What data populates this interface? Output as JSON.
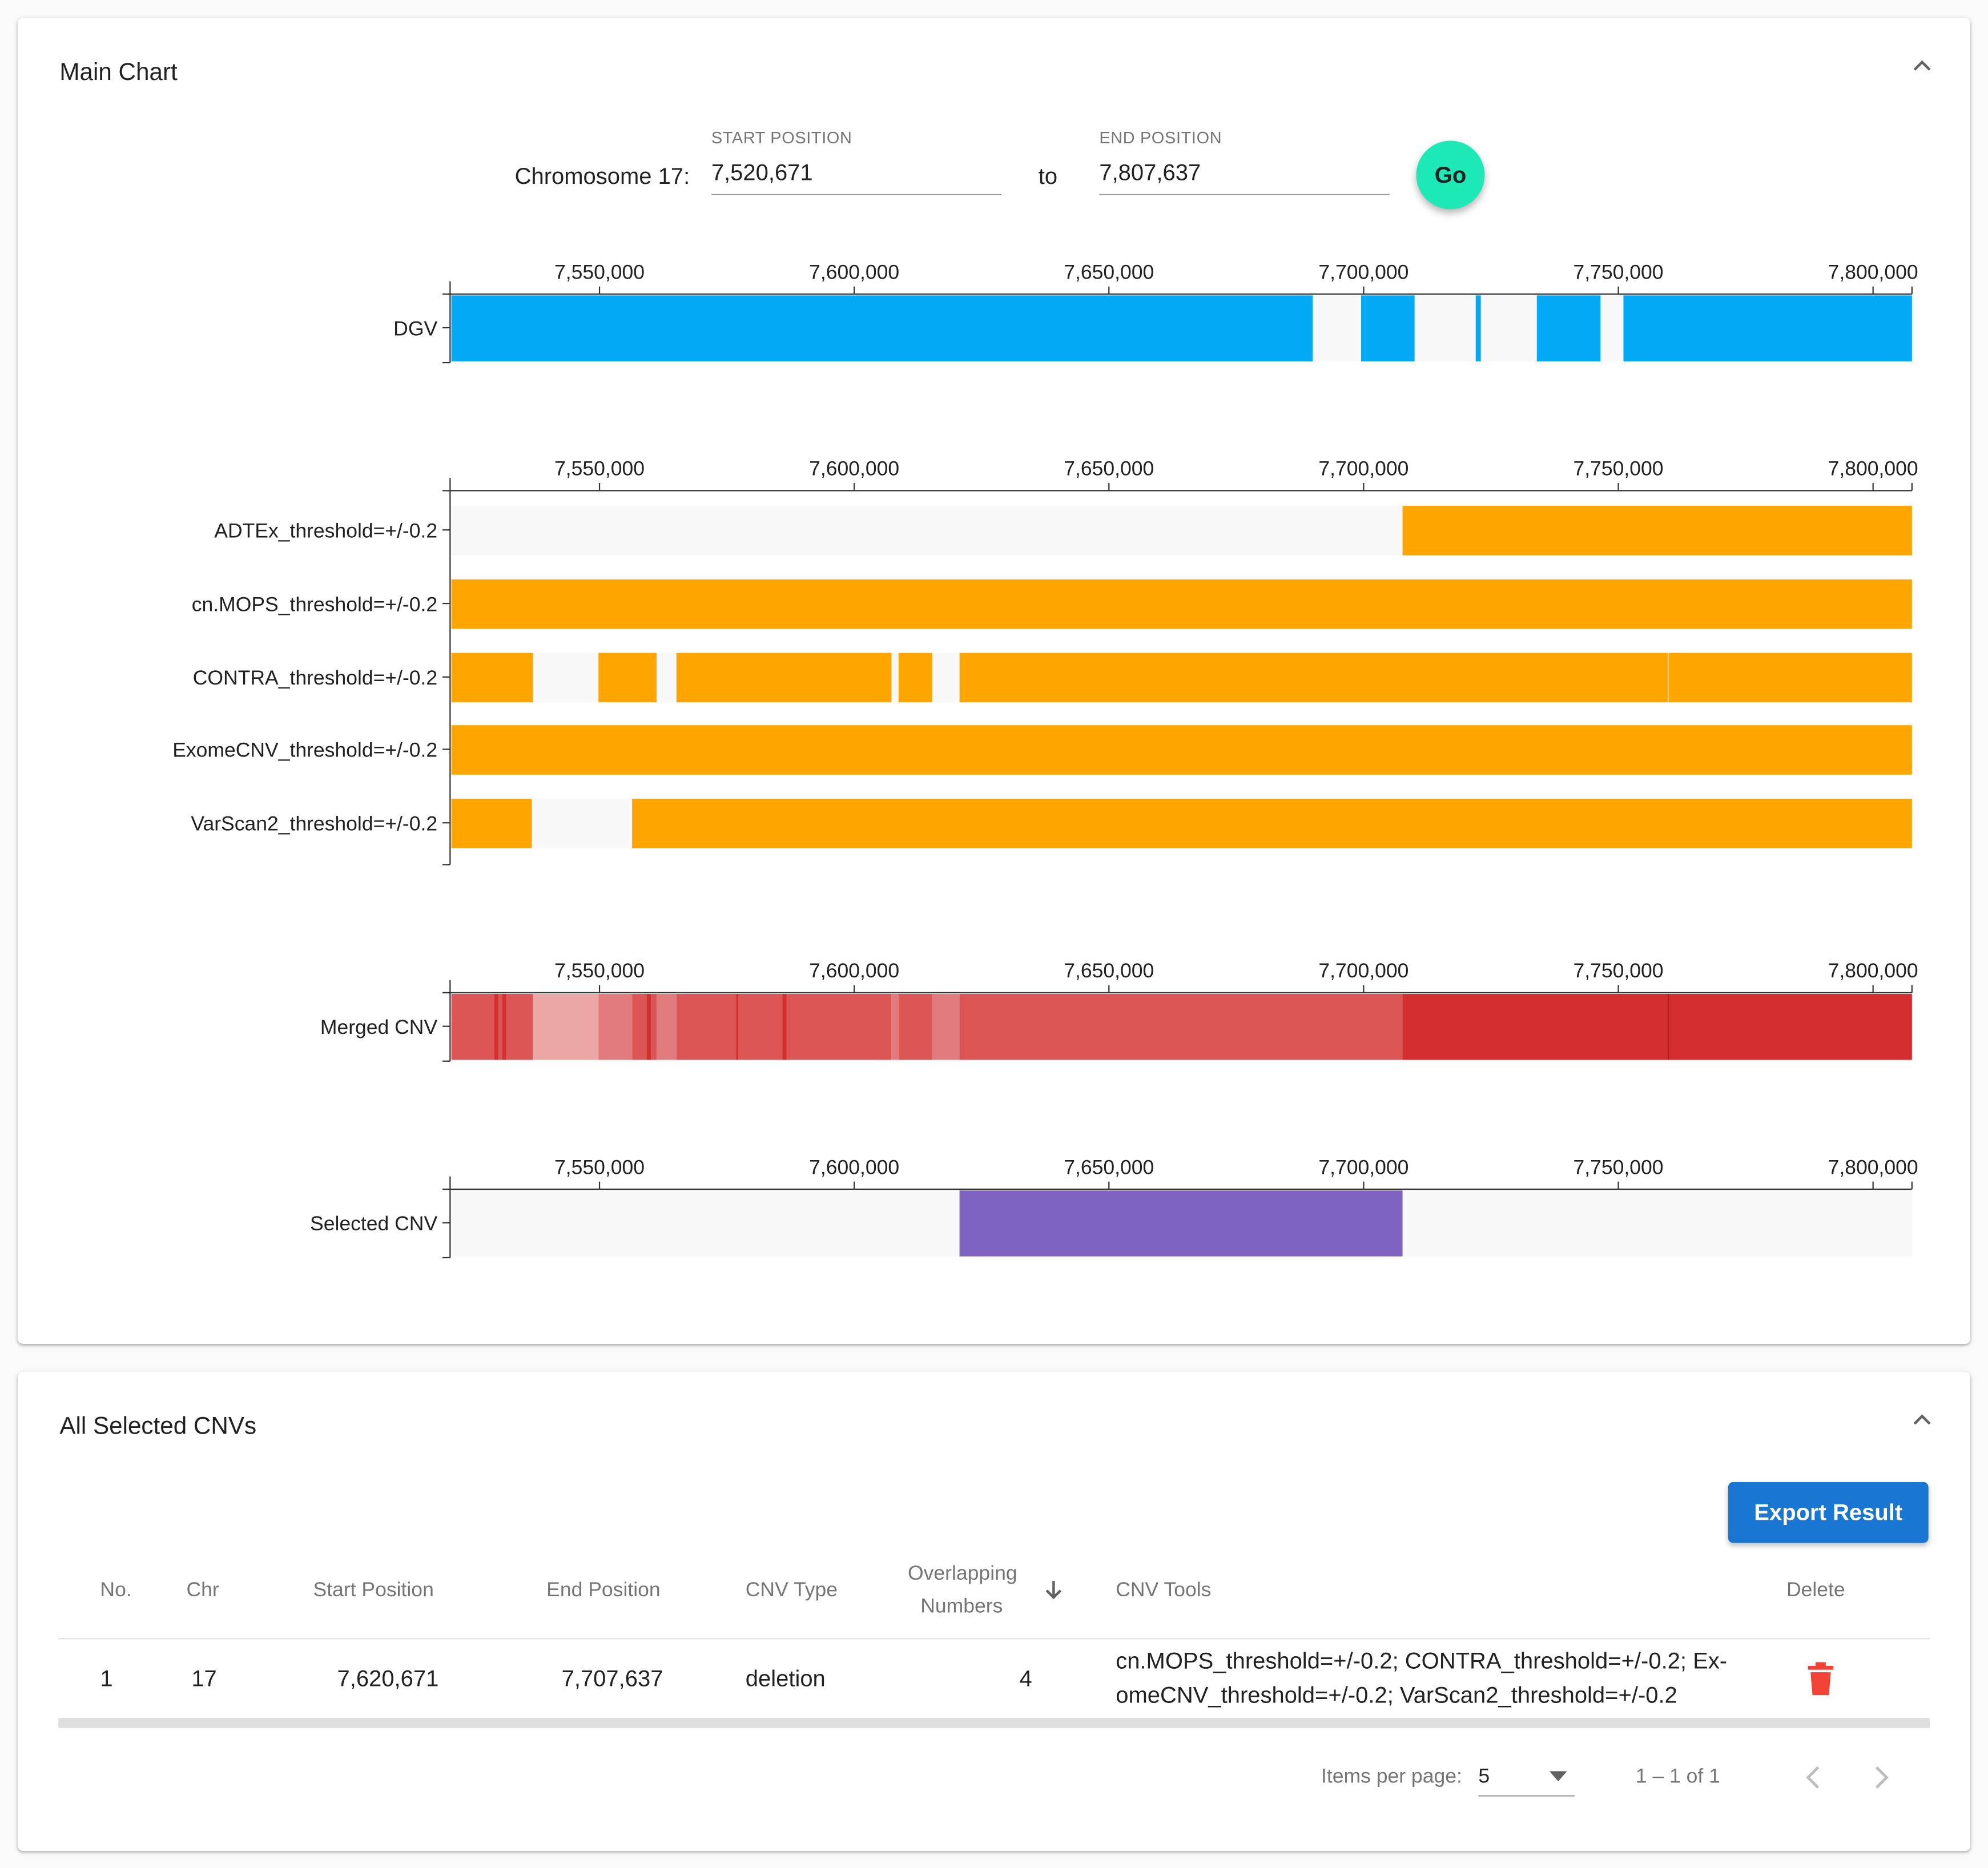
{
  "main_panel": {
    "title": "Main Chart",
    "chromosome_label": "Chromosome 17:",
    "start_label": "START POSITION",
    "start_value": "7,520,671",
    "to_label": "to",
    "end_label": "END POSITION",
    "end_value": "7,807,637",
    "go_label": "Go"
  },
  "chart_data": {
    "type": "bar",
    "x_domain": [
      7520671,
      7807637
    ],
    "tick_values": [
      7550000,
      7600000,
      7650000,
      7700000,
      7750000,
      7800000
    ],
    "tick_labels": [
      "7,550,000",
      "7,600,000",
      "7,650,000",
      "7,700,000",
      "7,750,000",
      "7,800,000"
    ],
    "colors": {
      "dgv": "#03a9f4",
      "tool": "#ffa500",
      "selected": "#7e63c0",
      "background": "#f8f8f8"
    },
    "tracks": [
      {
        "id": "dgv",
        "label": "DGV",
        "segments": [
          [
            7520671,
            7690000
          ],
          [
            7699500,
            7700300
          ],
          [
            7700300,
            7710000
          ],
          [
            7722000,
            7723000
          ],
          [
            7734000,
            7746500
          ],
          [
            7751000,
            7807637
          ]
        ]
      },
      {
        "id": "adtex",
        "label": "ADTEx_threshold=+/-0.2",
        "segments": [
          [
            7707637,
            7807637
          ]
        ]
      },
      {
        "id": "cnmops",
        "label": "cn.MOPS_threshold=+/-0.2",
        "segments": [
          [
            7520671,
            7807637
          ]
        ]
      },
      {
        "id": "contra",
        "label": "CONTRA_threshold=+/-0.2",
        "segments": [
          [
            7520671,
            7536900
          ],
          [
            7549800,
            7561200
          ],
          [
            7565100,
            7607300
          ],
          [
            7608700,
            7615300
          ],
          [
            7620671,
            7759800
          ],
          [
            7759800,
            7807637
          ]
        ]
      },
      {
        "id": "exomecnv",
        "label": "ExomeCNV_threshold=+/-0.2",
        "segments": [
          [
            7520671,
            7807637
          ]
        ]
      },
      {
        "id": "varscan2",
        "label": "VarScan2_threshold=+/-0.2",
        "segments": [
          [
            7520671,
            7536700
          ],
          [
            7556400,
            7807637
          ]
        ]
      },
      {
        "id": "merged",
        "label": "Merged CNV",
        "segments": [
          {
            "x": [
              7520671,
              7529300
            ],
            "c": "#dc5555"
          },
          {
            "x": [
              7529300,
              7530100
            ],
            "c": "#d32f2f"
          },
          {
            "x": [
              7530100,
              7530900
            ],
            "c": "#dc5555"
          },
          {
            "x": [
              7530900,
              7531700
            ],
            "c": "#d32f2f"
          },
          {
            "x": [
              7531700,
              7536900
            ],
            "c": "#dc5555"
          },
          {
            "x": [
              7536900,
              7549800
            ],
            "c": "#eba6a6"
          },
          {
            "x": [
              7549800,
              7556400
            ],
            "c": "#e27b7b"
          },
          {
            "x": [
              7556400,
              7559300
            ],
            "c": "#dc5555"
          },
          {
            "x": [
              7559300,
              7560100
            ],
            "c": "#d32f2f"
          },
          {
            "x": [
              7560100,
              7561200
            ],
            "c": "#dc5555"
          },
          {
            "x": [
              7561200,
              7565100
            ],
            "c": "#e27b7b"
          },
          {
            "x": [
              7565100,
              7576800
            ],
            "c": "#dc5555"
          },
          {
            "x": [
              7576800,
              7577300
            ],
            "c": "#d32f2f"
          },
          {
            "x": [
              7577300,
              7585900
            ],
            "c": "#dc5555"
          },
          {
            "x": [
              7585900,
              7586700
            ],
            "c": "#d32f2f"
          },
          {
            "x": [
              7586700,
              7607300
            ],
            "c": "#dc5555"
          },
          {
            "x": [
              7607300,
              7608700
            ],
            "c": "#e27b7b"
          },
          {
            "x": [
              7608700,
              7615300
            ],
            "c": "#dc5555"
          },
          {
            "x": [
              7615300,
              7620671
            ],
            "c": "#e27b7b"
          },
          {
            "x": [
              7620671,
              7707637
            ],
            "c": "#dc5555"
          },
          {
            "x": [
              7707637,
              7759800
            ],
            "c": "#d32f2f"
          },
          {
            "x": [
              7759800,
              7807637
            ],
            "c": "#d32f2f"
          }
        ]
      },
      {
        "id": "selected",
        "label": "Selected CNV",
        "segments": [
          [
            7620671,
            7707637
          ]
        ]
      }
    ]
  },
  "table_panel": {
    "title": "All Selected CNVs",
    "export_label": "Export Result",
    "headers": {
      "no": "No.",
      "chr": "Chr",
      "start": "Start Position",
      "end": "End Position",
      "type": "CNV Type",
      "overlap_1": "Overlapping",
      "overlap_2": "Numbers",
      "sort_icon": "arrow-down-icon",
      "tools": "CNV Tools",
      "delete": "Delete"
    },
    "rows": [
      {
        "no": "1",
        "chr": "17",
        "start": "7,620,671",
        "end": "7,707,637",
        "type": "deletion",
        "overlap": "4",
        "tools_line1": "cn.MOPS_threshold=+/-0.2; CONTRA_threshold=+/-0.2; Ex-",
        "tools_line2": "omeCNV_threshold=+/-0.2; VarScan2_threshold=+/-0.2",
        "delete_icon": "trash-icon"
      }
    ],
    "paginator": {
      "items_per_page_label": "Items per page:",
      "page_size": "5",
      "range_label": "1 – 1 of 1"
    }
  }
}
